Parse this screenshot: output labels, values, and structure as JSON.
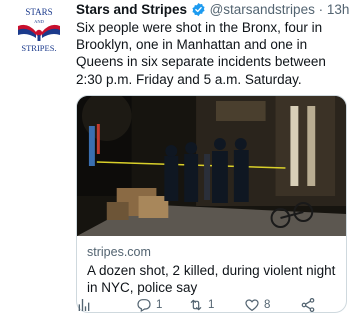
{
  "author": {
    "avatar_text": [
      "STARS",
      "AND",
      "STRIPES."
    ],
    "name": "Stars and Stripes",
    "verified_icon": "verified-badge-icon",
    "handle": "@starsandstripes",
    "separator": "·",
    "time": "13h"
  },
  "tweet": {
    "text": "Six people were shot in the Bronx, four in Brooklyn, one in Manhattan and one in Queens in six separate incidents between 2:30 p.m. Friday and 5 a.m. Saturday."
  },
  "card": {
    "domain": "stripes.com",
    "title": "A dozen shot, 2 killed, during violent night in NYC, police say",
    "image_alt": "Night street scene with police officers"
  },
  "actions": {
    "analytics": {
      "icon": "analytics-icon",
      "count": ""
    },
    "reply": {
      "icon": "reply-icon",
      "count": "1"
    },
    "retweet": {
      "icon": "retweet-icon",
      "count": "1"
    },
    "like": {
      "icon": "like-icon",
      "count": "8"
    },
    "share": {
      "icon": "share-icon",
      "count": ""
    }
  },
  "colors": {
    "accent": "#1d9bf0",
    "muted": "#536471",
    "avatar_red": "#c8102e",
    "avatar_blue": "#1b3a8c"
  }
}
